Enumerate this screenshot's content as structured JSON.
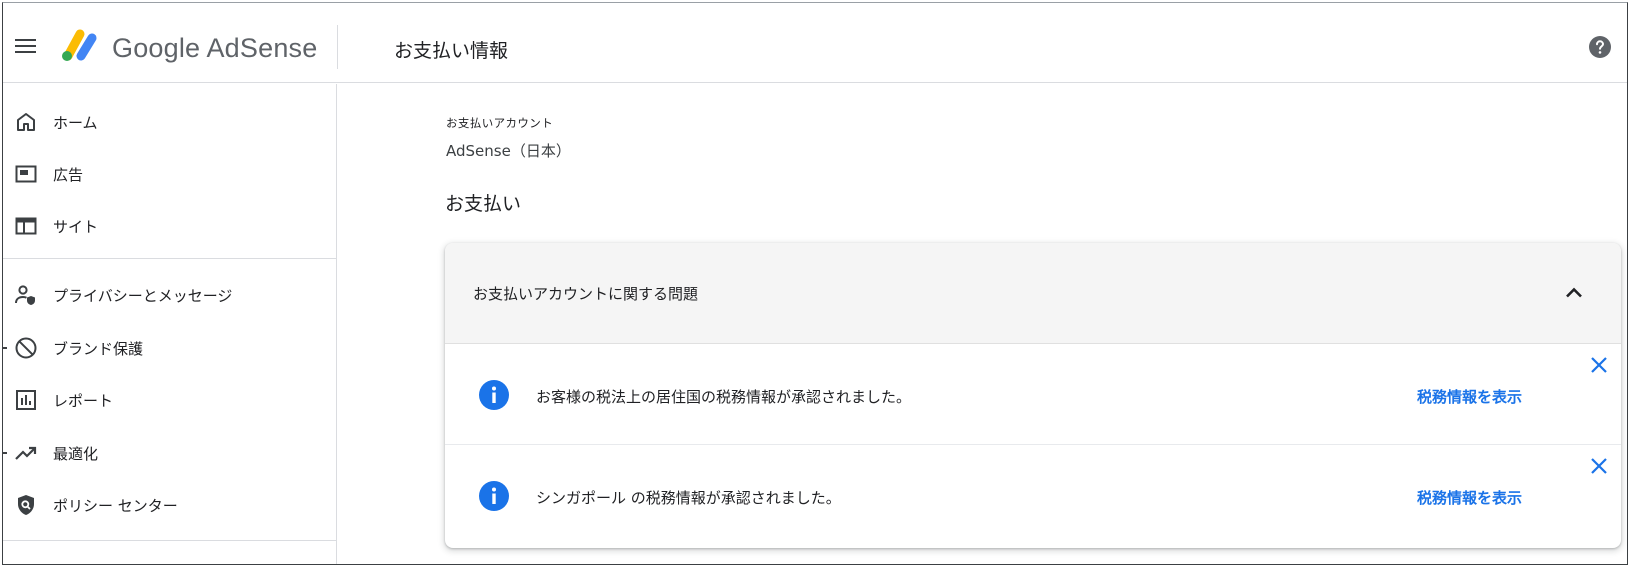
{
  "app": {
    "brand": "Google AdSense",
    "page_title": "お支払い情報"
  },
  "sidebar": {
    "items": [
      {
        "label": "ホーム",
        "icon": "home-icon"
      },
      {
        "label": "広告",
        "icon": "ads-icon"
      },
      {
        "label": "サイト",
        "icon": "sites-icon"
      },
      {
        "label": "プライバシーとメッセージ",
        "icon": "privacy-icon"
      },
      {
        "label": "ブランド保護",
        "icon": "block-icon"
      },
      {
        "label": "レポート",
        "icon": "reports-icon"
      },
      {
        "label": "最適化",
        "icon": "trending-up-icon"
      },
      {
        "label": "ポリシー センター",
        "icon": "policy-shield-icon"
      }
    ]
  },
  "main": {
    "account_label": "お支払いアカウント",
    "account_value": "AdSense（日本）",
    "section_title": "お支払い",
    "card": {
      "title": "お支払いアカウントに関する問題",
      "notices": [
        {
          "text": "お客様の税法上の居住国の税務情報が承認されました。",
          "link": "税務情報を表示"
        },
        {
          "text": "シンガポール の税務情報が承認されました。",
          "link": "税務情報を表示"
        }
      ]
    }
  },
  "colors": {
    "accent": "#1a73e8",
    "icon": "#3c4043",
    "card_header_bg": "#f5f5f5"
  }
}
